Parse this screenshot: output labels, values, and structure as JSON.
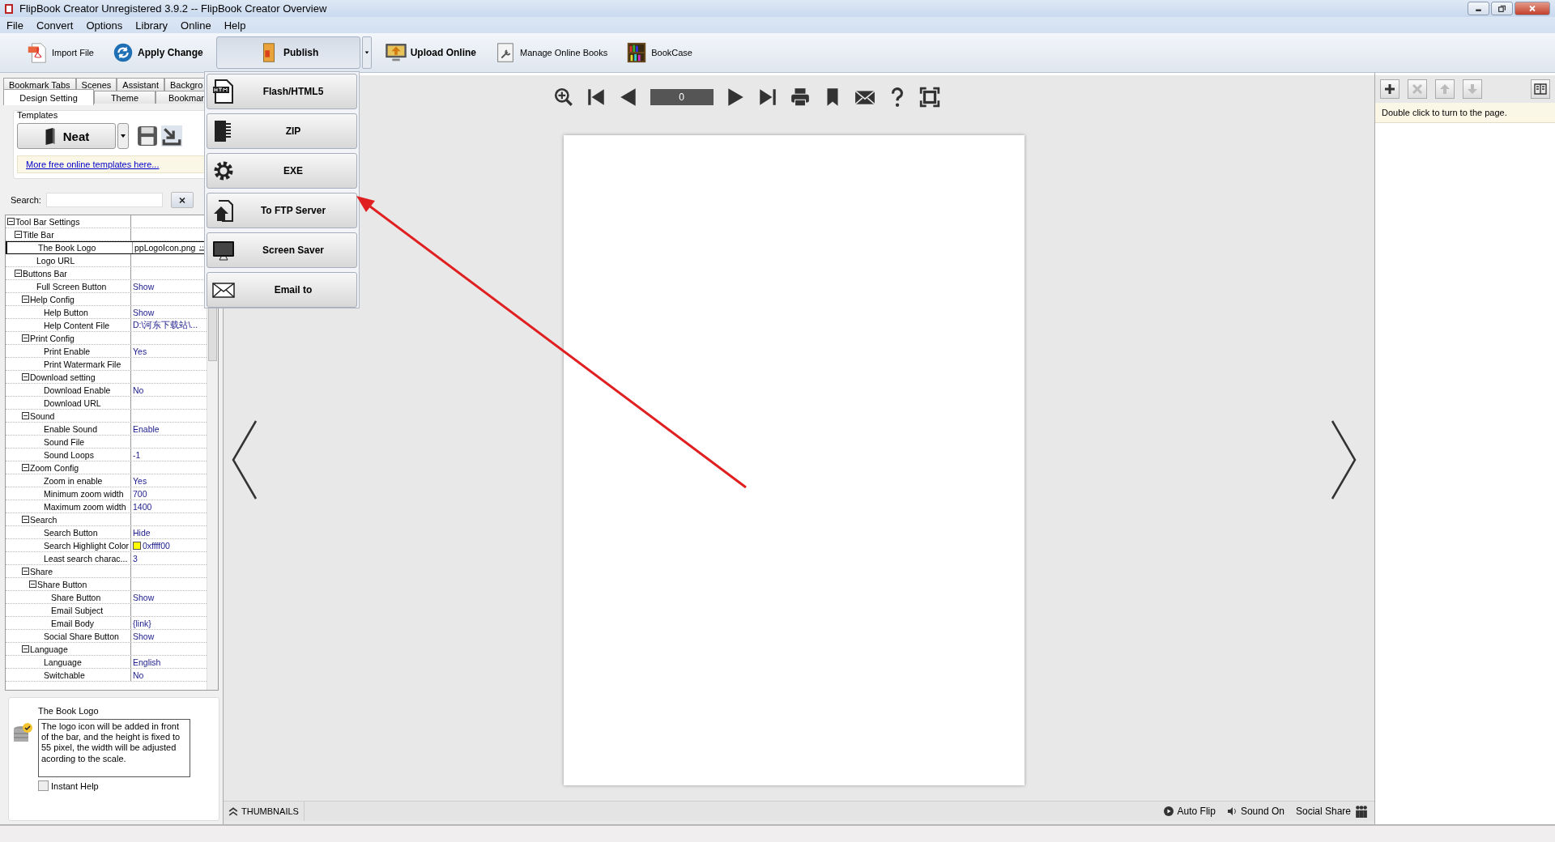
{
  "window": {
    "title": "FlipBook Creator Unregistered 3.9.2  -- FlipBook Creator Overview"
  },
  "menu": [
    "File",
    "Convert",
    "Options",
    "Library",
    "Online",
    "Help"
  ],
  "toolbar": [
    {
      "label": "Import File",
      "kind": "normal",
      "expanded": false
    },
    {
      "label": "Apply Change",
      "kind": "primary",
      "expanded": false
    },
    {
      "label": "Publish",
      "kind": "split",
      "expanded": true
    },
    {
      "label": "Upload Online",
      "kind": "primary",
      "expanded": false
    },
    {
      "label": "Manage Online Books",
      "kind": "normal",
      "expanded": false
    },
    {
      "label": "BookCase",
      "kind": "normal",
      "expanded": false
    }
  ],
  "publish_menu": [
    "Flash/HTML5",
    "ZIP",
    "EXE",
    "To FTP Server",
    "Screen Saver",
    "Email to"
  ],
  "left_panel": {
    "tabs_row_1": [
      {
        "label": "Bookmark Tabs",
        "selected": false
      },
      {
        "label": "Scenes",
        "selected": false
      },
      {
        "label": "Assistant",
        "selected": false
      },
      {
        "label": "Backgro",
        "selected": false
      }
    ],
    "tabs_row_2": [
      {
        "label": "Design Setting",
        "selected": true
      },
      {
        "label": "Theme",
        "selected": false
      },
      {
        "label": "Bookmar",
        "selected": false
      }
    ],
    "templates": {
      "title": "Templates",
      "template": "Neat",
      "link": "More free online templates here..."
    },
    "search": {
      "label": "Search:"
    },
    "tree": [
      {
        "label": "Tool Bar Settings",
        "expanded": true,
        "selected": false,
        "children": [
          {
            "label": "Title Bar",
            "expanded": true,
            "selected": false,
            "children": [
              {
                "label": "The Book Logo",
                "value": "ppLogoIcon.png",
                "selected": true
              },
              {
                "label": "Logo URL",
                "selected": false
              }
            ]
          },
          {
            "label": "Buttons Bar",
            "expanded": true,
            "selected": false,
            "children": [
              {
                "label": "Full Screen Button",
                "value": "Show",
                "selected": false
              },
              {
                "label": "Help Config",
                "expanded": true,
                "selected": false,
                "children": [
                  {
                    "label": "Help Button",
                    "value": "Show",
                    "selected": false
                  },
                  {
                    "label": "Help Content File",
                    "value": "D:\\河东下载站\\...",
                    "selected": false
                  }
                ]
              },
              {
                "label": "Print Config",
                "expanded": true,
                "selected": false,
                "children": [
                  {
                    "label": "Print Enable",
                    "value": "Yes",
                    "selected": false
                  },
                  {
                    "label": "Print Watermark File",
                    "selected": false
                  }
                ]
              },
              {
                "label": "Download setting",
                "expanded": true,
                "selected": false,
                "children": [
                  {
                    "label": "Download Enable",
                    "value": "No",
                    "selected": false
                  },
                  {
                    "label": "Download URL",
                    "selected": false
                  }
                ]
              },
              {
                "label": "Sound",
                "expanded": true,
                "selected": false,
                "children": [
                  {
                    "label": "Enable Sound",
                    "value": "Enable",
                    "selected": false
                  },
                  {
                    "label": "Sound File",
                    "selected": false
                  },
                  {
                    "label": "Sound Loops",
                    "value": "-1",
                    "selected": false
                  }
                ]
              },
              {
                "label": "Zoom Config",
                "expanded": true,
                "selected": false,
                "children": [
                  {
                    "label": "Zoom in enable",
                    "value": "Yes",
                    "selected": false
                  },
                  {
                    "label": "Minimum zoom width",
                    "value": "700",
                    "selected": false
                  },
                  {
                    "label": "Maximum zoom width",
                    "value": "1400",
                    "selected": false
                  }
                ]
              },
              {
                "label": "Search",
                "expanded": true,
                "selected": false,
                "children": [
                  {
                    "label": "Search Button",
                    "value": "Hide",
                    "selected": false
                  },
                  {
                    "label": "Search Highlight Color",
                    "value": "0xffff00",
                    "color": "#ffff00",
                    "selected": false
                  },
                  {
                    "label": "Least search charac...",
                    "value": "3",
                    "selected": false
                  }
                ]
              },
              {
                "label": "Share",
                "expanded": true,
                "selected": false,
                "children": [
                  {
                    "label": "Share Button",
                    "expanded": true,
                    "selected": false,
                    "children": [
                      {
                        "label": "Share Button",
                        "value": "Show",
                        "selected": false
                      },
                      {
                        "label": "Email Subject",
                        "selected": false
                      },
                      {
                        "label": "Email Body",
                        "value": "{link}",
                        "selected": false
                      }
                    ]
                  },
                  {
                    "label": "Social Share Button",
                    "value": "Show",
                    "selected": false
                  }
                ]
              },
              {
                "label": "Language",
                "expanded": true,
                "selected": false,
                "children": [
                  {
                    "label": "Language",
                    "value": "English",
                    "selected": false
                  },
                  {
                    "label": "Switchable",
                    "value": "No",
                    "selected": false
                  }
                ]
              }
            ]
          }
        ]
      }
    ],
    "help": {
      "title": "The Book Logo",
      "text": "The logo icon will be added in front of the bar, and the height is fixed to 55 pixel, the width will be adjusted acording to the scale.",
      "instant_help": {
        "label": "Instant Help",
        "checked": false
      }
    }
  },
  "viewer": {
    "page_field": "0"
  },
  "bottom_bar": {
    "thumbnails": "THUMBNAILS",
    "auto_flip": "Auto Flip",
    "sound": "Sound On",
    "social_share": "Social Share"
  },
  "right_panel": {
    "tools": [
      {
        "disabled": false
      },
      {
        "disabled": true
      },
      {
        "disabled": true
      },
      {
        "disabled": true
      },
      {
        "disabled": false
      }
    ],
    "hint": "Double click to turn to the page."
  }
}
